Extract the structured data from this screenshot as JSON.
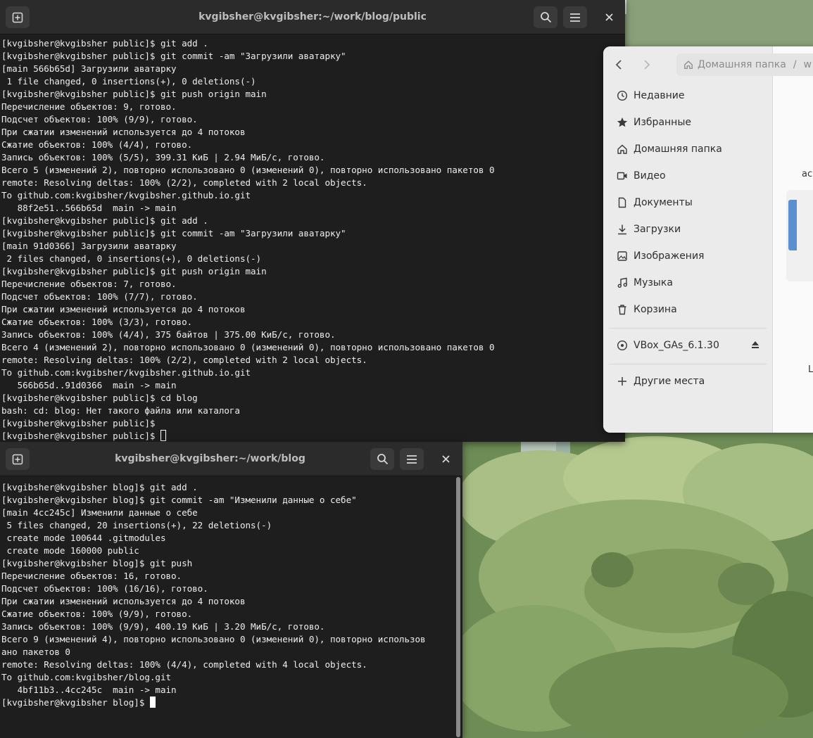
{
  "terminal_top": {
    "title": "kvgibsher@kvgibsher:~/work/blog/public",
    "lines": [
      "[kvgibsher@kvgibsher public]$ git add .",
      "[kvgibsher@kvgibsher public]$ git commit -am \"Загрузили аватарку\"",
      "[main 566b65d] Загрузили аватарку",
      " 1 file changed, 0 insertions(+), 0 deletions(-)",
      "[kvgibsher@kvgibsher public]$ git push origin main",
      "Перечисление объектов: 9, готово.",
      "Подсчет объектов: 100% (9/9), готово.",
      "При сжатии изменений используется до 4 потоков",
      "Сжатие объектов: 100% (4/4), готово.",
      "Запись объектов: 100% (5/5), 399.31 КиБ | 2.94 МиБ/с, готово.",
      "Всего 5 (изменений 2), повторно использовано 0 (изменений 0), повторно использовано пакетов 0",
      "remote: Resolving deltas: 100% (2/2), completed with 2 local objects.",
      "To github.com:kvgibsher/kvgibsher.github.io.git",
      "   88f2e51..566b65d  main -> main",
      "[kvgibsher@kvgibsher public]$ git add .",
      "[kvgibsher@kvgibsher public]$ git commit -am \"Загрузили аватарку\"",
      "[main 91d0366] Загрузили аватарку",
      " 2 files changed, 0 insertions(+), 0 deletions(-)",
      "[kvgibsher@kvgibsher public]$ git push origin main",
      "Перечисление объектов: 7, готово.",
      "Подсчет объектов: 100% (7/7), готово.",
      "При сжатии изменений используется до 4 потоков",
      "Сжатие объектов: 100% (3/3), готово.",
      "Запись объектов: 100% (4/4), 375 байтов | 375.00 КиБ/с, готово.",
      "Всего 4 (изменений 2), повторно использовано 0 (изменений 0), повторно использовано пакетов 0",
      "remote: Resolving deltas: 100% (2/2), completed with 2 local objects.",
      "To github.com:kvgibsher/kvgibsher.github.io.git",
      "   566b65d..91d0366  main -> main",
      "[kvgibsher@kvgibsher public]$ cd blog",
      "bash: cd: blog: Нет такого файла или каталога",
      "[kvgibsher@kvgibsher public]$ ",
      "[kvgibsher@kvgibsher public]$ "
    ]
  },
  "terminal_bottom": {
    "title": "kvgibsher@kvgibsher:~/work/blog",
    "lines": [
      "[kvgibsher@kvgibsher blog]$ git add .",
      "[kvgibsher@kvgibsher blog]$ git commit -am \"Изменили данные о себе\"",
      "[main 4cc245c] Изменили данные о себе",
      " 5 files changed, 20 insertions(+), 22 deletions(-)",
      " create mode 100644 .gitmodules",
      " create mode 160000 public",
      "[kvgibsher@kvgibsher blog]$ git push",
      "Перечисление объектов: 16, готово.",
      "Подсчет объектов: 100% (16/16), готово.",
      "При сжатии изменений используется до 4 потоков",
      "Сжатие объектов: 100% (9/9), готово.",
      "Запись объектов: 100% (9/9), 400.19 КиБ | 3.20 МиБ/с, готово.",
      "Всего 9 (изменений 4), повторно использовано 0 (изменений 0), повторно использов",
      "ано пакетов 0",
      "remote: Resolving deltas: 100% (4/4), completed with 4 local objects.",
      "To github.com:kvgibsher/blog.git",
      "   4bf11b3..4cc245c  main -> main",
      "[kvgibsher@kvgibsher blog]$ "
    ]
  },
  "file_manager": {
    "breadcrumb": "Домашняя папка",
    "breadcrumb_sep": "/",
    "breadcrumb_next": "w",
    "places": [
      {
        "label": "Недавние",
        "icon": "clock-icon"
      },
      {
        "label": "Избранные",
        "icon": "star-icon"
      },
      {
        "label": "Домашняя папка",
        "icon": "home-icon"
      },
      {
        "label": "Видео",
        "icon": "video-icon"
      },
      {
        "label": "Документы",
        "icon": "document-icon"
      },
      {
        "label": "Загрузки",
        "icon": "download-icon"
      },
      {
        "label": "Изображения",
        "icon": "image-icon"
      },
      {
        "label": "Музыка",
        "icon": "music-icon"
      },
      {
        "label": "Корзина",
        "icon": "trash-icon"
      }
    ],
    "device": {
      "label": "VBox_GAs_6.1.30",
      "icon": "disc-icon"
    },
    "other": {
      "label": "Другие места",
      "icon": "plus-icon"
    },
    "content_fragment_1": "ac",
    "content_fragment_2": "L"
  }
}
